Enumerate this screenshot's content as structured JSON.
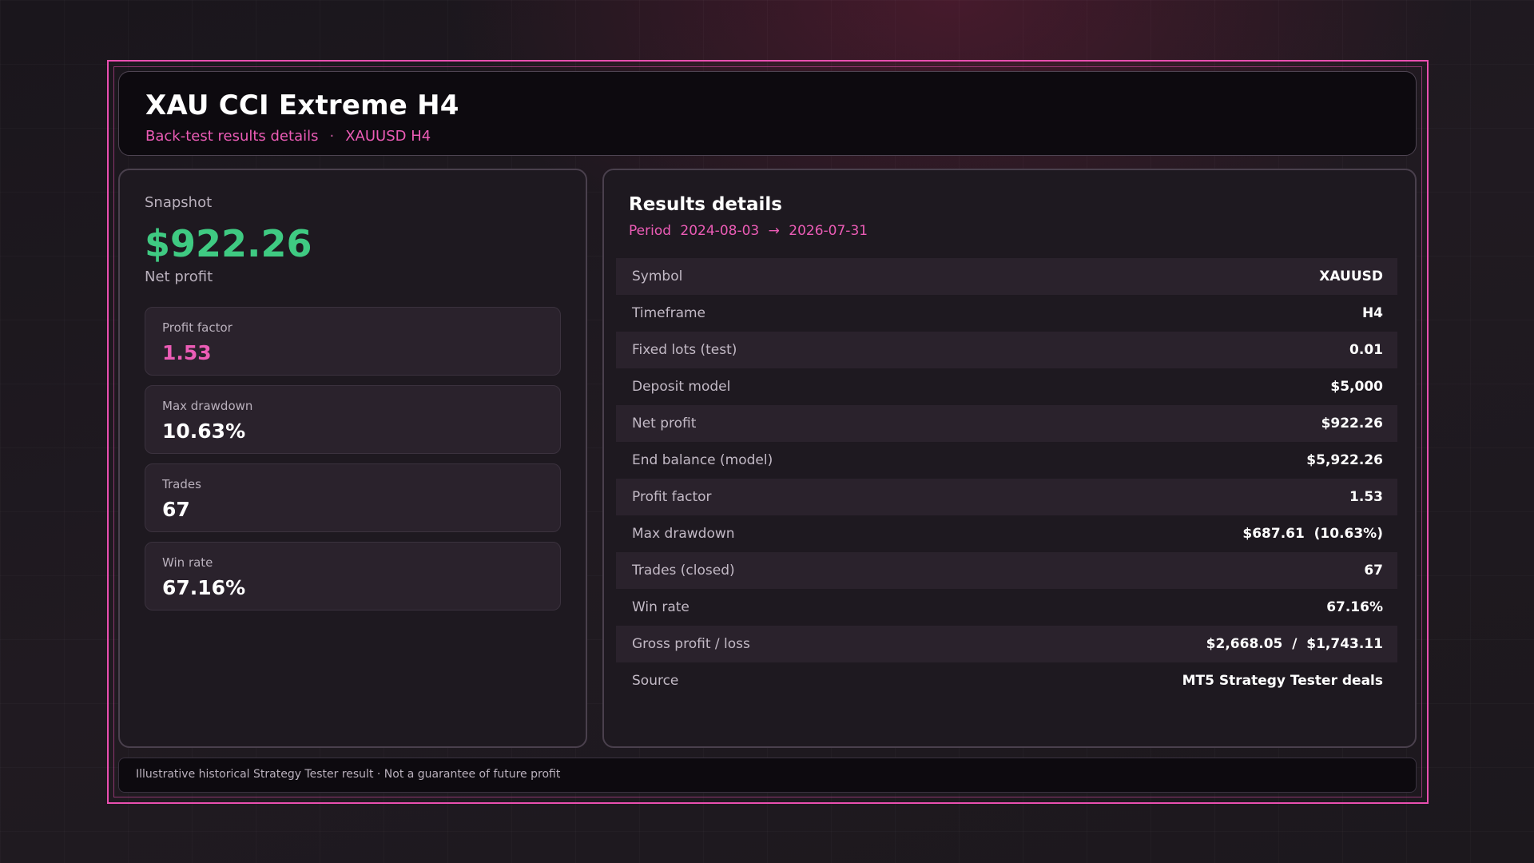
{
  "header": {
    "title": "XAU CCI Extreme H4",
    "subtitle_left": "Back-test results details",
    "subtitle_sep": "·",
    "subtitle_right": "XAUUSD H4"
  },
  "snapshot": {
    "label": "Snapshot",
    "net_value": "$922.26",
    "net_label": "Net profit",
    "stats": [
      {
        "label": "Profit factor",
        "value": "1.53"
      },
      {
        "label": "Max drawdown",
        "value": "10.63%"
      },
      {
        "label": "Trades",
        "value": "67"
      },
      {
        "label": "Win rate",
        "value": "67.16%"
      }
    ]
  },
  "results": {
    "title": "Results details",
    "period_label": "Period",
    "period_start": "2024-08-03",
    "period_arrow": "→",
    "period_end": "2026-07-31",
    "rows": [
      {
        "label": "Symbol",
        "value": "XAUUSD"
      },
      {
        "label": "Timeframe",
        "value": "H4"
      },
      {
        "label": "Fixed lots (test)",
        "value": "0.01"
      },
      {
        "label": "Deposit model",
        "value": "$5,000"
      },
      {
        "label": "Net profit",
        "value": "$922.26"
      },
      {
        "label": "End balance (model)",
        "value": "$5,922.26"
      },
      {
        "label": "Profit factor",
        "value": "1.53"
      },
      {
        "label": "Max drawdown",
        "value": "$687.61  (10.63%)"
      },
      {
        "label": "Trades (closed)",
        "value": "67"
      },
      {
        "label": "Win rate",
        "value": "67.16%"
      },
      {
        "label": "Gross profit / loss",
        "value": "$2,668.05  /  $1,743.11"
      },
      {
        "label": "Source",
        "value": "MT5 Strategy Tester deals"
      }
    ]
  },
  "footer": {
    "text": "Illustrative historical Strategy Tester result · Not a guarantee of future profit"
  },
  "colors": {
    "accent_pink": "#ec5cb6",
    "profit_green": "#3fca82",
    "frame_border": "#e94fb0"
  }
}
